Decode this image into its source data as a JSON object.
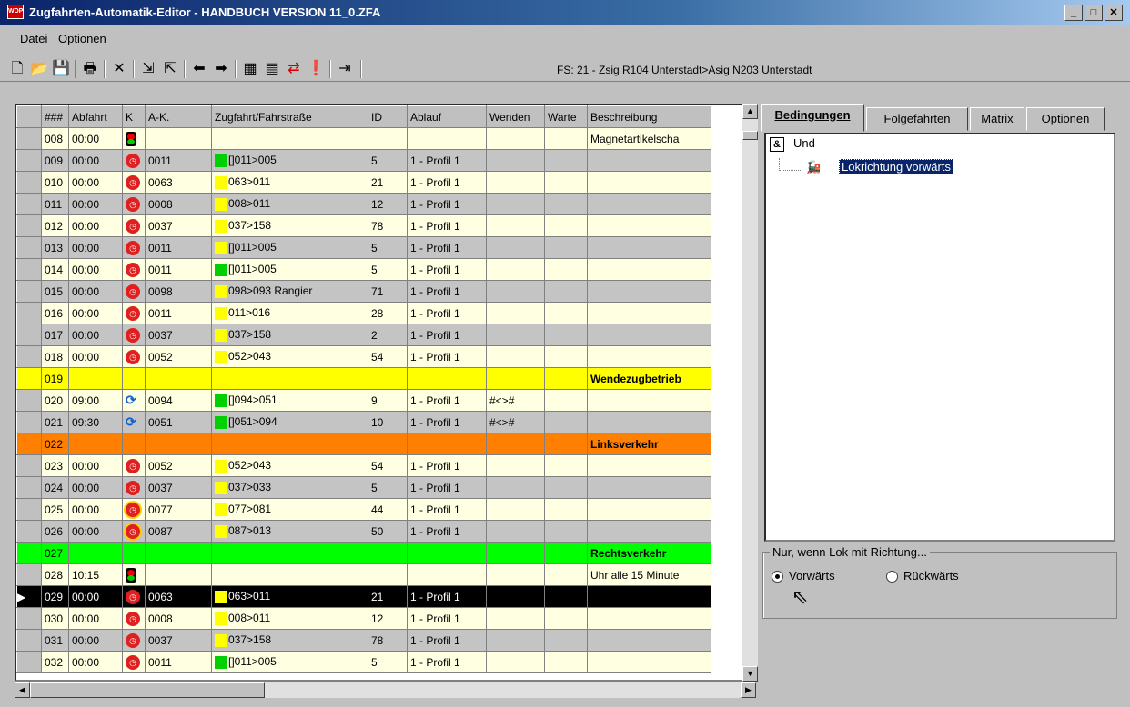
{
  "window": {
    "title": "Zugfahrten-Automatik-Editor - HANDBUCH VERSION 11_0.ZFA",
    "app_icon_text": "WDP"
  },
  "menu": {
    "items": [
      "Datei",
      "Optionen"
    ]
  },
  "toolbar": {
    "status_text": "FS: 21 - Zsig R104 Unterstadt>Asig N203 Unterstadt"
  },
  "grid": {
    "headers": [
      "###",
      "Abfahrt",
      "K",
      "A-K.",
      "Zugfahrt/Fahrstraße",
      "ID",
      "Ablauf",
      "Wenden",
      "Warte",
      "Beschreibung"
    ],
    "rows": [
      {
        "num": "008",
        "time": "00:00",
        "k": "signal",
        "ak": "",
        "route": "",
        "swatch": "",
        "id": "",
        "ablauf": "",
        "wenden": "",
        "desc": "Magnetartikelscha",
        "style": "cy"
      },
      {
        "num": "009",
        "time": "00:00",
        "k": "clock",
        "ak": "0011",
        "route": "[]011>005",
        "swatch": "green",
        "id": "5",
        "ablauf": "1 - Profil 1",
        "wenden": "",
        "desc": "",
        "style": "cg"
      },
      {
        "num": "010",
        "time": "00:00",
        "k": "clock",
        "ak": "0063",
        "route": "063>011",
        "swatch": "yellow",
        "id": "21",
        "ablauf": "1 - Profil 1",
        "wenden": "",
        "desc": "",
        "style": "cy"
      },
      {
        "num": "011",
        "time": "00:00",
        "k": "clock",
        "ak": "0008",
        "route": "008>011",
        "swatch": "yellow",
        "id": "12",
        "ablauf": "1 - Profil 1",
        "wenden": "",
        "desc": "",
        "style": "cg"
      },
      {
        "num": "012",
        "time": "00:00",
        "k": "clock",
        "ak": "0037",
        "route": "037>158",
        "swatch": "yellow",
        "id": "78",
        "ablauf": "1 - Profil 1",
        "wenden": "",
        "desc": "",
        "style": "cy"
      },
      {
        "num": "013",
        "time": "00:00",
        "k": "clock",
        "ak": "0011",
        "route": "[]011>005",
        "swatch": "yellow",
        "id": "5",
        "ablauf": "1 - Profil 1",
        "wenden": "",
        "desc": "",
        "style": "cg"
      },
      {
        "num": "014",
        "time": "00:00",
        "k": "clock",
        "ak": "0011",
        "route": "[]011>005",
        "swatch": "green",
        "id": "5",
        "ablauf": "1 - Profil 1",
        "wenden": "",
        "desc": "",
        "style": "cy"
      },
      {
        "num": "015",
        "time": "00:00",
        "k": "clock",
        "ak": "0098",
        "route": "098>093 Rangier",
        "swatch": "yellow",
        "id": "71",
        "ablauf": "1 - Profil 1",
        "wenden": "",
        "desc": "",
        "style": "cg"
      },
      {
        "num": "016",
        "time": "00:00",
        "k": "clock",
        "ak": "0011",
        "route": "011>016",
        "swatch": "yellow",
        "id": "28",
        "ablauf": "1 - Profil 1",
        "wenden": "",
        "desc": "",
        "style": "cy"
      },
      {
        "num": "017",
        "time": "00:00",
        "k": "clock",
        "ak": "0037",
        "route": "037>158",
        "swatch": "yellow",
        "id": "2",
        "ablauf": "1 - Profil 1",
        "wenden": "",
        "desc": "",
        "style": "cg"
      },
      {
        "num": "018",
        "time": "00:00",
        "k": "clock",
        "ak": "0052",
        "route": "052>043",
        "swatch": "yellow",
        "id": "54",
        "ablauf": "1 - Profil 1",
        "wenden": "",
        "desc": "",
        "style": "cy"
      },
      {
        "num": "019",
        "time": "",
        "k": "",
        "ak": "",
        "route": "",
        "swatch": "",
        "id": "",
        "ablauf": "",
        "wenden": "",
        "desc": "Wendezugbetrieb",
        "style": "ryel"
      },
      {
        "num": "020",
        "time": "09:00",
        "k": "swap",
        "ak": "0094",
        "route": "[]094>051",
        "swatch": "green",
        "id": "9",
        "ablauf": "1 - Profil 1",
        "wenden": "#<>#",
        "desc": "",
        "style": "cy"
      },
      {
        "num": "021",
        "time": "09:30",
        "k": "swap",
        "ak": "0051",
        "route": "[]051>094",
        "swatch": "green",
        "id": "10",
        "ablauf": "1 - Profil 1",
        "wenden": "#<>#",
        "desc": "",
        "style": "cg"
      },
      {
        "num": "022",
        "time": "",
        "k": "",
        "ak": "",
        "route": "",
        "swatch": "",
        "id": "",
        "ablauf": "",
        "wenden": "",
        "desc": "Linksverkehr",
        "style": "rora"
      },
      {
        "num": "023",
        "time": "00:00",
        "k": "clock",
        "ak": "0052",
        "route": "052>043",
        "swatch": "yellow",
        "id": "54",
        "ablauf": "1 - Profil 1",
        "wenden": "",
        "desc": "",
        "style": "cy"
      },
      {
        "num": "024",
        "time": "00:00",
        "k": "clock",
        "ak": "0037",
        "route": "037>033",
        "swatch": "yellow",
        "id": "5",
        "ablauf": "1 - Profil 1",
        "wenden": "",
        "desc": "",
        "style": "cg"
      },
      {
        "num": "025",
        "time": "00:00",
        "k": "clock-ring",
        "ak": "0077",
        "route": "077>081",
        "swatch": "yellow",
        "id": "44",
        "ablauf": "1 - Profil 1",
        "wenden": "",
        "desc": "",
        "style": "cy"
      },
      {
        "num": "026",
        "time": "00:00",
        "k": "clock-ring",
        "ak": "0087",
        "route": "087>013",
        "swatch": "yellow",
        "id": "50",
        "ablauf": "1 - Profil 1",
        "wenden": "",
        "desc": "",
        "style": "cg"
      },
      {
        "num": "027",
        "time": "",
        "k": "",
        "ak": "",
        "route": "",
        "swatch": "",
        "id": "",
        "ablauf": "",
        "wenden": "",
        "desc": "Rechtsverkehr",
        "style": "rgrn"
      },
      {
        "num": "028",
        "time": "10:15",
        "k": "signal",
        "ak": "",
        "route": "",
        "swatch": "",
        "id": "",
        "ablauf": "",
        "wenden": "",
        "desc": "Uhr alle 15 Minute",
        "style": "cy"
      },
      {
        "num": "029",
        "time": "00:00",
        "k": "clock",
        "ak": "0063",
        "route": "063>011",
        "swatch": "yellow",
        "id": "21",
        "ablauf": "1 - Profil 1",
        "wenden": "",
        "desc": "",
        "style": "rsel"
      },
      {
        "num": "030",
        "time": "00:00",
        "k": "clock",
        "ak": "0008",
        "route": "008>011",
        "swatch": "yellow",
        "id": "12",
        "ablauf": "1 - Profil 1",
        "wenden": "",
        "desc": "",
        "style": "cy"
      },
      {
        "num": "031",
        "time": "00:00",
        "k": "clock",
        "ak": "0037",
        "route": "037>158",
        "swatch": "yellow",
        "id": "78",
        "ablauf": "1 - Profil 1",
        "wenden": "",
        "desc": "",
        "style": "cg"
      },
      {
        "num": "032",
        "time": "00:00",
        "k": "clock",
        "ak": "0011",
        "route": "[]011>005",
        "swatch": "green",
        "id": "5",
        "ablauf": "1 - Profil 1",
        "wenden": "",
        "desc": "",
        "style": "cy"
      }
    ]
  },
  "panel": {
    "tabs": [
      "Bedingungen",
      "Folgefahrten",
      "Matrix",
      "Optionen"
    ],
    "tree": {
      "root": "Und",
      "child": "Lokrichtung vorwärts"
    },
    "group_label": "Nur, wenn Lok mit Richtung...",
    "radio_forward": "Vorwärts",
    "radio_backward": "Rückwärts"
  }
}
